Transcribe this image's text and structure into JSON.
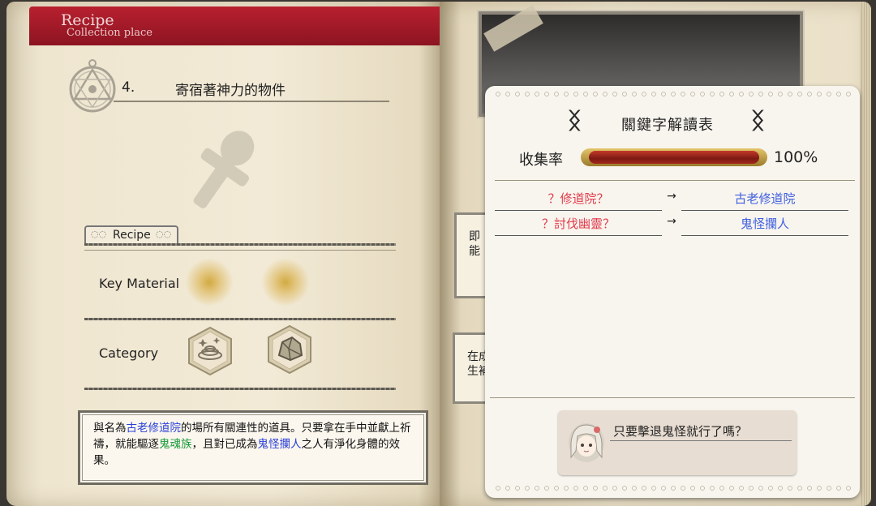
{
  "header": {
    "title": "Recipe",
    "subtitle": "Collection place"
  },
  "recipe": {
    "number": "4.",
    "name": "寄宿著神力的物件",
    "tab_label": "Recipe",
    "key_material_label": "Key Material",
    "category_label": "Category",
    "category_icons": [
      "swirl-icon",
      "rock-icon"
    ],
    "description": {
      "p1": "與名為",
      "h1": "古老修道院",
      "p2": "的場所有關連性的道具。只要拿在手中並獻上祈禱，就能驅逐",
      "h2": "鬼魂族",
      "p3": "，且對已成為",
      "h3": "鬼怪攔人",
      "p4": "之人有淨化身體的效果。"
    }
  },
  "background_cards": {
    "card1_line1": "即",
    "card1_line2": "能",
    "card2_line1": "在成",
    "card2_line2": "生補"
  },
  "keyword_panel": {
    "title": "關鍵字解讀表",
    "rate_label": "收集率",
    "rate_value": "100%",
    "rate_fraction": 1.0,
    "arrow": "→",
    "rows": [
      {
        "unknown": "？修道院？",
        "known": "古老修道院"
      },
      {
        "unknown": "？討伐幽靈？",
        "known": "鬼怪攔人"
      }
    ]
  },
  "dialog": {
    "text": "只要擊退鬼怪就行了嗎？"
  },
  "colors": {
    "ribbon": "#a51a29",
    "unknown_keyword": "#e23b4c",
    "known_keyword": "#3f5fe0",
    "highlight_blue": "#2a3fd8",
    "highlight_green": "#179a38"
  }
}
